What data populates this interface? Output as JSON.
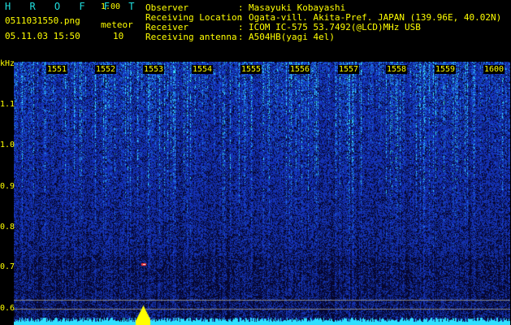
{
  "app": {
    "title": "H R O F F T",
    "version": "1.00"
  },
  "meta": {
    "filename": "0511031550.png",
    "type_label": "meteor",
    "datetime": "05.11.03 15:50",
    "meteor_count": "10"
  },
  "info": [
    {
      "label": "Observer",
      "sep": ":",
      "value": "Masayuki Kobayashi"
    },
    {
      "label": "Receiving Location",
      "sep": ":",
      "value": "Ogata-vill. Akita-Pref. JAPAN (139.96E, 40.02N)"
    },
    {
      "label": "Receiver",
      "sep": ":",
      "value": "ICOM IC-575 53.7492(@LCD)MHz USB"
    },
    {
      "label": "Receiving antenna",
      "sep": ":",
      "value": "A504HB(yagi 4el)"
    }
  ],
  "axis": {
    "y_unit": "kHz",
    "y_ticks": [
      "1.1",
      "1.0",
      "0.9",
      "0.8",
      "0.7",
      "0.6"
    ],
    "x_ticks": [
      "1551",
      "1552",
      "1553",
      "1554",
      "1555",
      "1556",
      "1557",
      "1558",
      "1559",
      "1600"
    ]
  },
  "colors": {
    "background": "#000000",
    "label": "#ffff00",
    "title": "#20e0e0",
    "spectrogram_base": "#06062e",
    "noise_low": "#1838c0",
    "noise_high": "#30f0ff",
    "grid_line": "#8a8a8a"
  }
}
